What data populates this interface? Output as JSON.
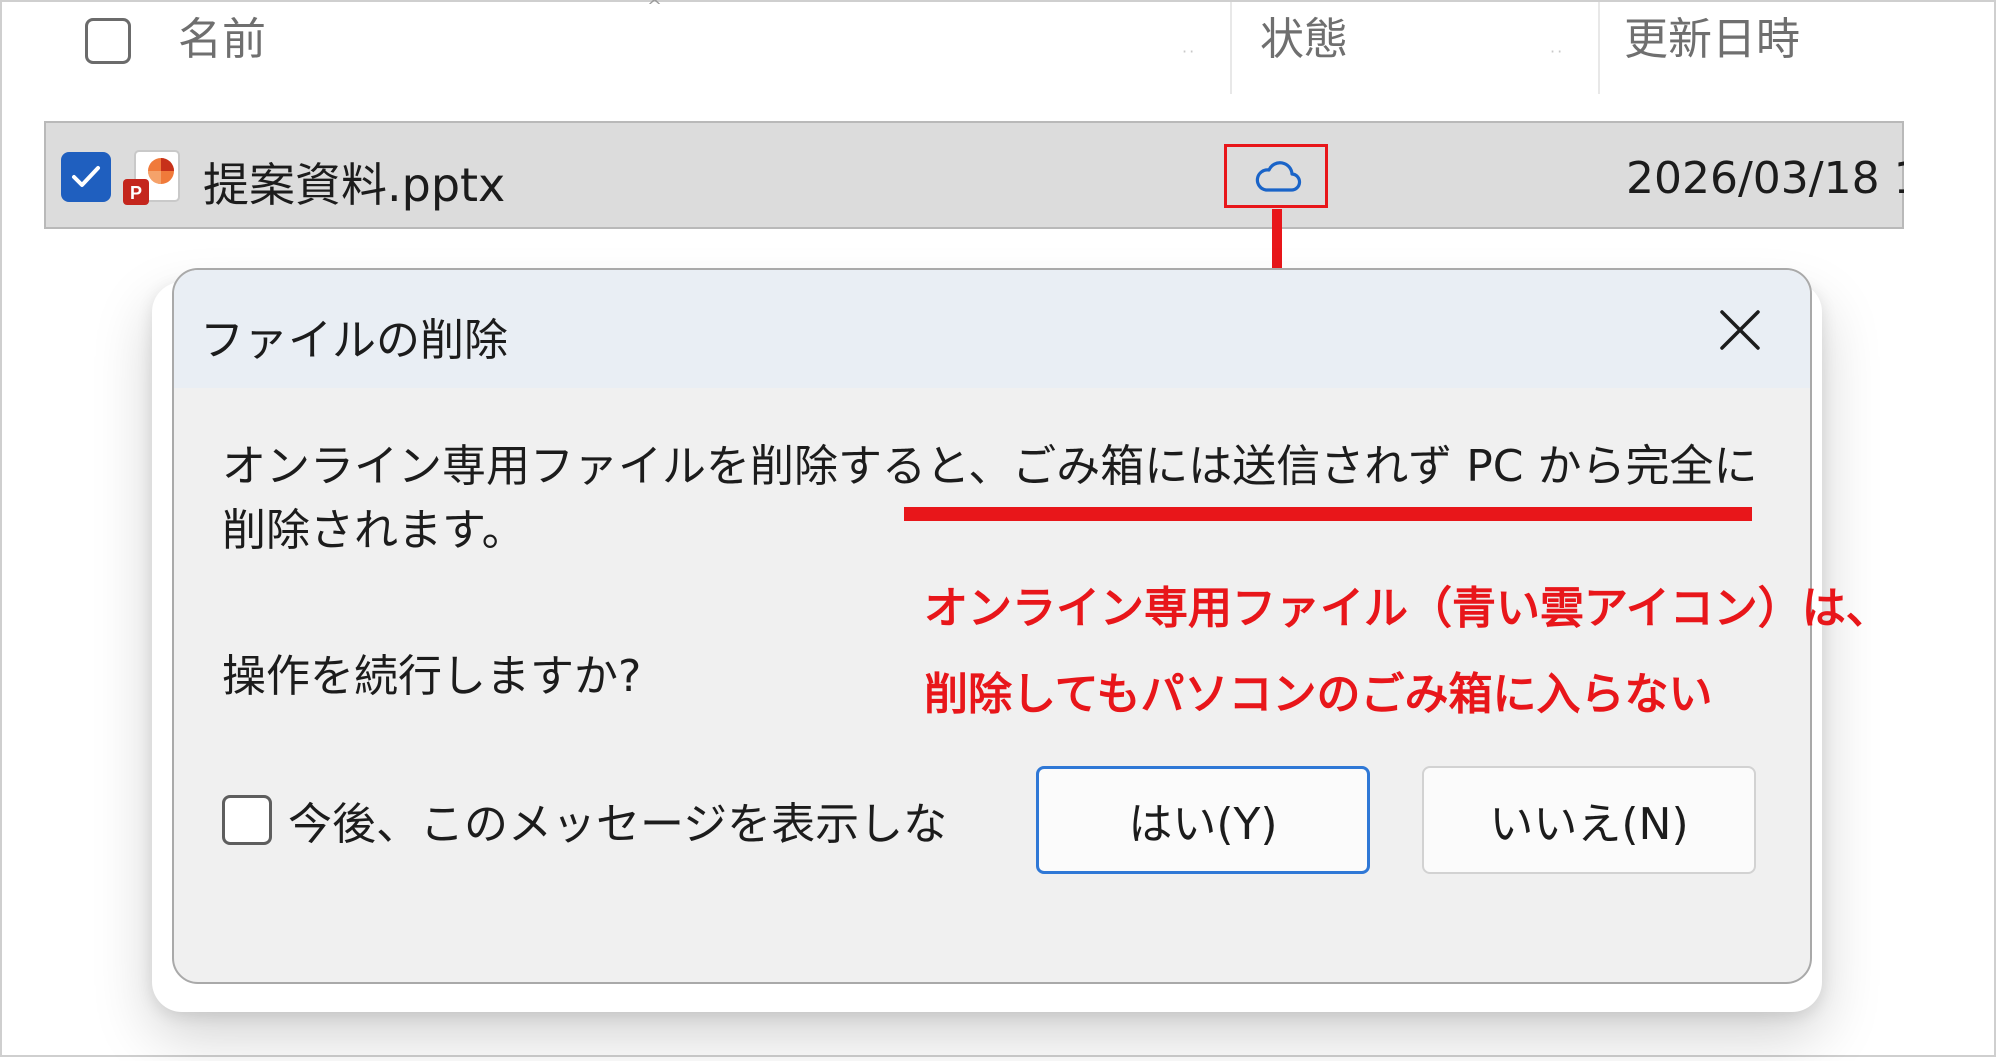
{
  "header": {
    "name_label": "名前",
    "status_label": "状態",
    "modified_label": "更新日時"
  },
  "file": {
    "name": "提案資料.pptx",
    "date": "2026/03/18 1",
    "status": "cloud-icon"
  },
  "dialog": {
    "title": "ファイルの削除",
    "message": "オンライン専用ファイルを削除すると、ごみ箱には送信されず PC から完全に削除されます。",
    "question": "操作を続行しますか?",
    "dont_show_label": "今後、このメッセージを表示しな",
    "yes_label": "はい(Y)",
    "no_label": "いいえ(N)"
  },
  "annotation": {
    "line1": "オンライン専用ファイル（青い雲アイコン）は、",
    "line2": "削除してもパソコンのごみ箱に入らない"
  },
  "colors": {
    "annotation_red": "#e8161a",
    "accent_blue": "#1f5fbf",
    "cloud_blue": "#1a64c8"
  }
}
